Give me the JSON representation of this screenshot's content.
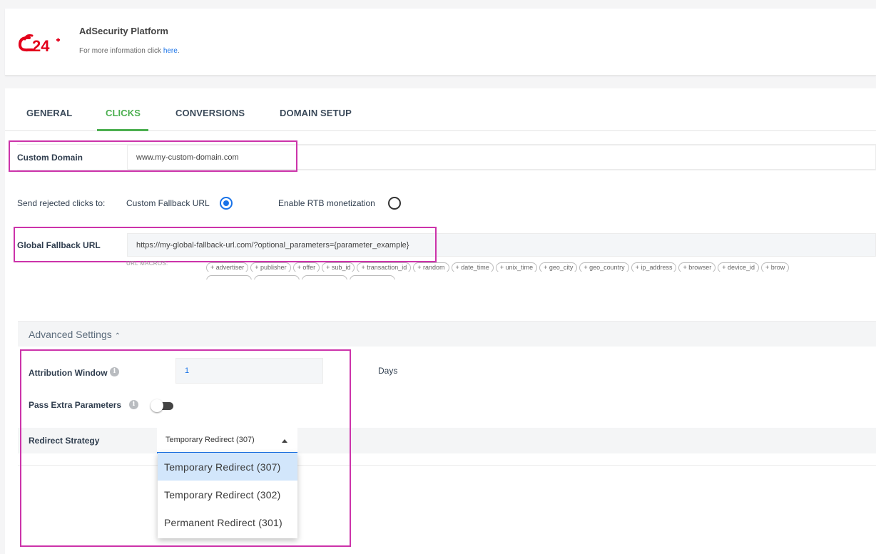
{
  "header": {
    "logo_text": "c24",
    "title": "AdSecurity Platform",
    "info_prefix": "For more information click ",
    "info_link": "here",
    "info_suffix": "."
  },
  "tabs": [
    {
      "label": "GENERAL"
    },
    {
      "label": "CLICKS"
    },
    {
      "label": "CONVERSIONS"
    },
    {
      "label": "DOMAIN SETUP"
    }
  ],
  "active_tab": "CLICKS",
  "custom_domain": {
    "label": "Custom Domain",
    "value": "www.my-custom-domain.com"
  },
  "rejected": {
    "label": "Send rejected clicks to:",
    "option1": "Custom Fallback URL",
    "option2": "Enable RTB monetization",
    "selected": "Custom Fallback URL"
  },
  "fallback": {
    "label": "Global Fallback URL",
    "value": "https://my-global-fallback-url.com/?optional_parameters={parameter_example}",
    "macros_label": "URL MACROS:",
    "macros": [
      "+ advertiser",
      "+ publisher",
      "+ offer",
      "+ sub_id",
      "+ transaction_id",
      "+ random",
      "+ date_time",
      "+ unix_time",
      "+ geo_city",
      "+ geo_country",
      "+ ip_address",
      "+ browser",
      "+ device_id",
      "+ brow"
    ]
  },
  "advanced": {
    "title": "Advanced Settings",
    "attribution_label": "Attribution Window",
    "attribution_value": "1",
    "attribution_unit": "Days",
    "pass_extra_label": "Pass Extra Parameters",
    "pass_extra_enabled": false,
    "redirect_label": "Redirect Strategy",
    "redirect_value": "Temporary Redirect (307)",
    "redirect_options": [
      "Temporary Redirect (307)",
      "Temporary Redirect (302)",
      "Permanent Redirect (301)"
    ]
  },
  "colors": {
    "accent_green": "#4caf50",
    "primary_blue": "#1a73e8",
    "highlight_magenta": "#cc33aa"
  }
}
